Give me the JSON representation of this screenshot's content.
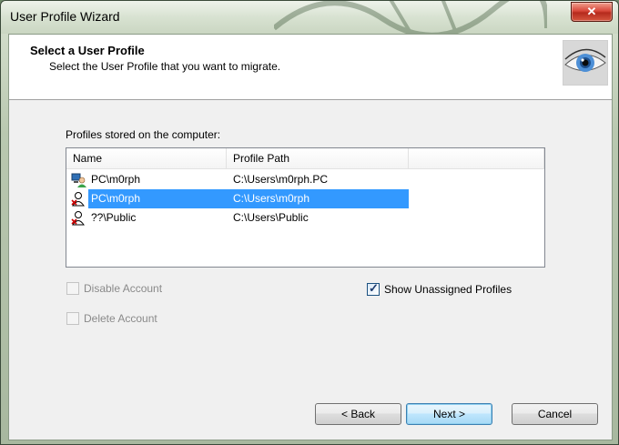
{
  "window": {
    "title": "User Profile Wizard",
    "close_glyph": "✕"
  },
  "header": {
    "title": "Select a User Profile",
    "subtitle": "Select the User Profile that you want to migrate.",
    "logo_icon": "eye-icon"
  },
  "profiles": {
    "label": "Profiles stored on the computer:",
    "columns": [
      "Name",
      "Profile Path"
    ],
    "rows": [
      {
        "name": "PC\\m0rph",
        "path": "C:\\Users\\m0rph.PC",
        "icon": "user-computer-icon",
        "selected": false
      },
      {
        "name": "PC\\m0rph",
        "path": "C:\\Users\\m0rph",
        "icon": "user-unassigned-icon",
        "selected": true
      },
      {
        "name": "??\\Public",
        "path": "C:\\Users\\Public",
        "icon": "user-unassigned-icon",
        "selected": false
      }
    ]
  },
  "options": {
    "disable_account": {
      "label": "Disable Account",
      "checked": false,
      "enabled": false
    },
    "delete_account": {
      "label": "Delete Account",
      "checked": false,
      "enabled": false
    },
    "show_unassigned": {
      "label": "Show Unassigned Profiles",
      "checked": true,
      "enabled": true
    }
  },
  "buttons": {
    "back": "< Back",
    "next": "Next >",
    "cancel": "Cancel"
  },
  "colors": {
    "selection": "#3399ff",
    "close_button": "#c7392b",
    "default_button_border": "#3c7fb1"
  }
}
